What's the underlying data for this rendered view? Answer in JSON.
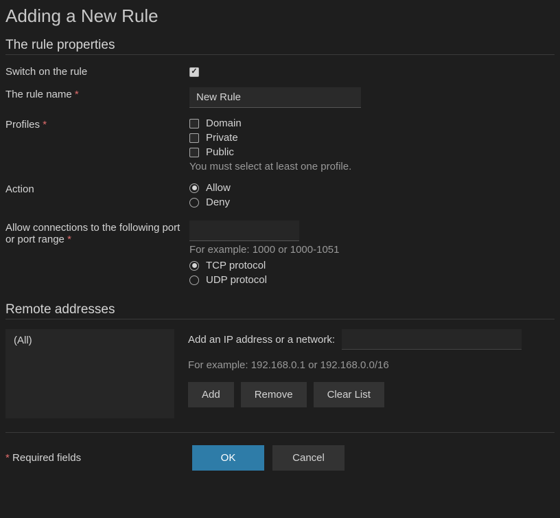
{
  "title": "Adding a New Rule",
  "ruleProperties": {
    "heading": "The rule properties",
    "switchOn": {
      "label": "Switch on the rule",
      "checked": true
    },
    "ruleName": {
      "label": "The rule name",
      "value": "New Rule",
      "required": true
    },
    "profiles": {
      "label": "Profiles",
      "required": true,
      "options": [
        {
          "label": "Domain",
          "checked": false
        },
        {
          "label": "Private",
          "checked": false
        },
        {
          "label": "Public",
          "checked": false
        }
      ],
      "helper": "You must select at least one profile."
    },
    "action": {
      "label": "Action",
      "options": [
        {
          "label": "Allow",
          "selected": true
        },
        {
          "label": "Deny",
          "selected": false
        }
      ]
    },
    "port": {
      "label": "Allow connections to the following port or port range",
      "required": true,
      "value": "",
      "helper": "For example: 1000 or 1000-1051",
      "protocolOptions": [
        {
          "label": "TCP protocol",
          "selected": true
        },
        {
          "label": "UDP protocol",
          "selected": false
        }
      ]
    }
  },
  "remoteAddresses": {
    "heading": "Remote addresses",
    "listDefault": "(All)",
    "ipLabel": "Add an IP address or a network:",
    "ipValue": "",
    "helper": "For example: 192.168.0.1 or 192.168.0.0/16",
    "buttons": {
      "add": "Add",
      "remove": "Remove",
      "clear": "Clear List"
    }
  },
  "footer": {
    "requiredLabel": "Required fields",
    "ok": "OK",
    "cancel": "Cancel"
  }
}
